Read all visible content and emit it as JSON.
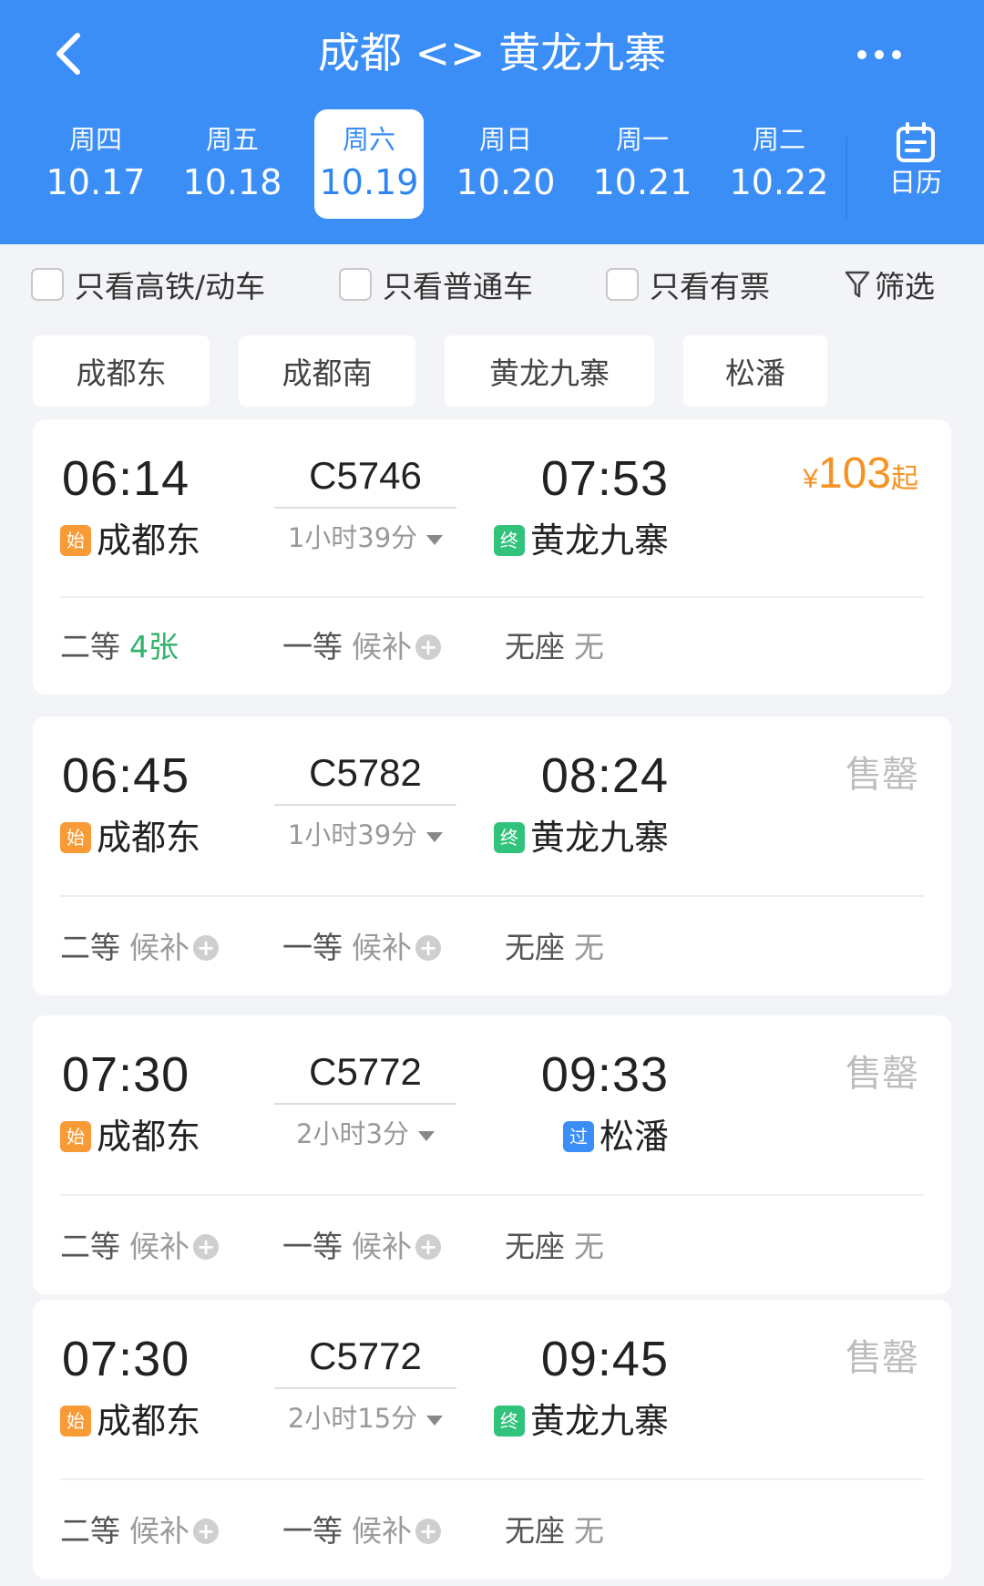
{
  "header": {
    "title": "成都 <> 黄龙九寨",
    "calendar_label": "日历"
  },
  "dates": [
    {
      "weekday": "周四",
      "date": "10.17"
    },
    {
      "weekday": "周五",
      "date": "10.18"
    },
    {
      "weekday": "周六",
      "date": "10.19",
      "selected": true
    },
    {
      "weekday": "周日",
      "date": "10.20"
    },
    {
      "weekday": "周一",
      "date": "10.21"
    },
    {
      "weekday": "周二",
      "date": "10.22"
    }
  ],
  "filters": {
    "high_speed": "只看高铁/动车",
    "regular": "只看普通车",
    "available": "只看有票",
    "filter_label": "筛选"
  },
  "stations": [
    "成都东",
    "成都南",
    "黄龙九寨",
    "松潘"
  ],
  "trains": [
    {
      "dep_time": "06:14",
      "train_no": "C5746",
      "arr_time": "07:53",
      "duration": "1小时39分",
      "dep_station": "成都东",
      "arr_station": "黄龙九寨",
      "dep_tag": "始",
      "arr_tag": "终",
      "price_symbol": "¥",
      "price": "103",
      "price_suffix": "起",
      "seats": [
        {
          "label": "二等",
          "value": "4张"
        },
        {
          "label": "一等",
          "value": "候补"
        },
        {
          "label": "无座",
          "value": "无"
        }
      ]
    },
    {
      "dep_time": "06:45",
      "train_no": "C5782",
      "arr_time": "08:24",
      "duration": "1小时39分",
      "dep_station": "成都东",
      "arr_station": "黄龙九寨",
      "dep_tag": "始",
      "arr_tag": "终",
      "status": "售罄",
      "seats": [
        {
          "label": "二等",
          "value": "候补"
        },
        {
          "label": "一等",
          "value": "候补"
        },
        {
          "label": "无座",
          "value": "无"
        }
      ]
    },
    {
      "dep_time": "07:30",
      "train_no": "C5772",
      "arr_time": "09:33",
      "duration": "2小时3分",
      "dep_station": "成都东",
      "arr_station": "松潘",
      "dep_tag": "始",
      "arr_tag": "过",
      "status": "售罄",
      "seats": [
        {
          "label": "二等",
          "value": "候补"
        },
        {
          "label": "一等",
          "value": "候补"
        },
        {
          "label": "无座",
          "value": "无"
        }
      ]
    },
    {
      "dep_time": "07:30",
      "train_no": "C5772",
      "arr_time": "09:45",
      "duration": "2小时15分",
      "dep_station": "成都东",
      "arr_station": "黄龙九寨",
      "dep_tag": "始",
      "arr_tag": "终",
      "status": "售罄",
      "seats": [
        {
          "label": "二等",
          "value": "候补"
        },
        {
          "label": "一等",
          "value": "候补"
        },
        {
          "label": "无座",
          "value": "无"
        }
      ]
    }
  ],
  "colors": {
    "header_bg": "#3b8ef6",
    "price": "#f59324",
    "available": "#31b26a",
    "tag_start": "#f89a35",
    "tag_end": "#31c27c",
    "tag_pass": "#3b8ef6"
  },
  "icons": {
    "back": "chevron-left-icon",
    "more": "more-dots-icon",
    "calendar": "calendar-icon",
    "filter": "funnel-icon",
    "expand": "caret-down-icon",
    "waitlist": "plus-circle-icon"
  }
}
